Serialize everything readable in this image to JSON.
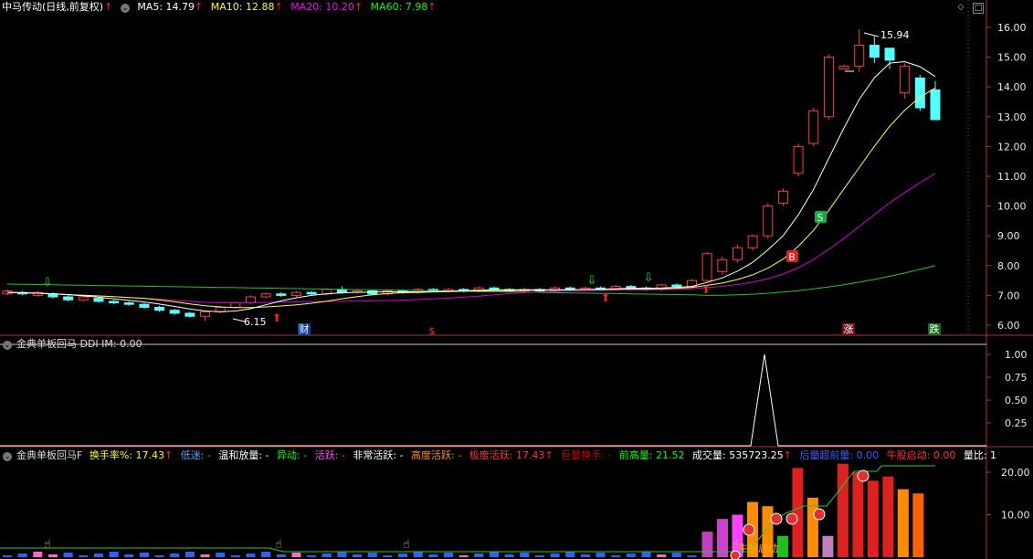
{
  "main_panel": {
    "title": "中马传动(日线,前复权)",
    "ma": [
      {
        "label": "MA5: 14.79",
        "color": "#ffffff"
      },
      {
        "label": "MA10: 12.88",
        "color": "#ffff00"
      },
      {
        "label": "MA20: 10.20",
        "color": "#ff00ff"
      },
      {
        "label": "MA60: 7.98",
        "color": "#00ff00"
      }
    ],
    "y_ticks": [
      "16.00",
      "15.00",
      "14.00",
      "13.00",
      "12.00",
      "11.00",
      "10.00",
      "9.00",
      "8.00",
      "7.00",
      "6.00"
    ],
    "high_label": "15.94",
    "low_label": "6.15",
    "markers": {
      "cai": "财",
      "dollar": "$",
      "zhang": "涨",
      "die": "跌",
      "b": "B",
      "s": "S"
    }
  },
  "ddi_panel": {
    "title": "金典单板回马 DDI IM: 0.00",
    "y_ticks": [
      "1.00",
      "0.75",
      "0.50",
      "0.25"
    ]
  },
  "volume_panel": {
    "title": "金典单板回马F",
    "fields": [
      {
        "label": "换手率%: 17.43",
        "color": "#ffff00"
      },
      {
        "label": "低迷: -",
        "color": "#4aa3ff"
      },
      {
        "label": "温和放量: -",
        "color": "#ffffff"
      },
      {
        "label": "异动: -",
        "color": "#00ff00"
      },
      {
        "label": "活跃: -",
        "color": "#ff44ff"
      },
      {
        "label": "非常活跃: -",
        "color": "#ffffff"
      },
      {
        "label": "高度活跃: -",
        "color": "#ff8c00"
      },
      {
        "label": "极度活跃: 17.43",
        "color": "#ff3030"
      },
      {
        "label": "巨量换手: -",
        "color": "#cc0000"
      },
      {
        "label": "前高量: 21.52",
        "color": "#00ff00"
      },
      {
        "label": "成交量: 535723.25",
        "color": "#ffffff"
      },
      {
        "label": "后量超前量: 0.00",
        "color": "#3a5aff"
      },
      {
        "label": "牛股启动: 0.00",
        "color": "#ff3030"
      },
      {
        "label": "量比: 1",
        "color": "#ffffff"
      }
    ],
    "y_ticks": [
      "20.00",
      "10.00"
    ],
    "start_label": "牛股启动"
  }
}
